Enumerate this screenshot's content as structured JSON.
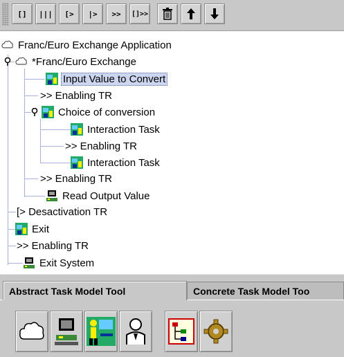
{
  "toolbar": {
    "buttons": [
      "[]",
      "|||",
      "[>",
      "|>",
      ">>",
      "[]>>"
    ],
    "delete_icon": "trash-icon",
    "up_icon": "arrow-up-icon",
    "down_icon": "arrow-down-icon"
  },
  "tree": {
    "root": "Franc/Euro Exchange Application",
    "items": [
      "*Franc/Euro Exchange",
      "Input Value to Convert",
      ">> Enabling TR",
      "Choice of conversion",
      "Interaction Task",
      ">> Enabling TR",
      "Interaction Task",
      ">> Enabling TR",
      "Read Output Value",
      "[> Desactivation TR",
      "Exit",
      ">> Enabling TR",
      "Exit System"
    ]
  },
  "tabs": {
    "abstract": "Abstract Task Model Tool",
    "concrete": "Concrete Task Model Too"
  },
  "palette": [
    "abstract-task-icon",
    "application-task-icon",
    "interaction-task-icon",
    "user-task-icon",
    "tree-view-icon",
    "gear-icon"
  ],
  "colors": {
    "toolbar_bg": "#c8c8c8",
    "selection": "#ccd6f0",
    "tree_lines": "#a8b4dc"
  }
}
